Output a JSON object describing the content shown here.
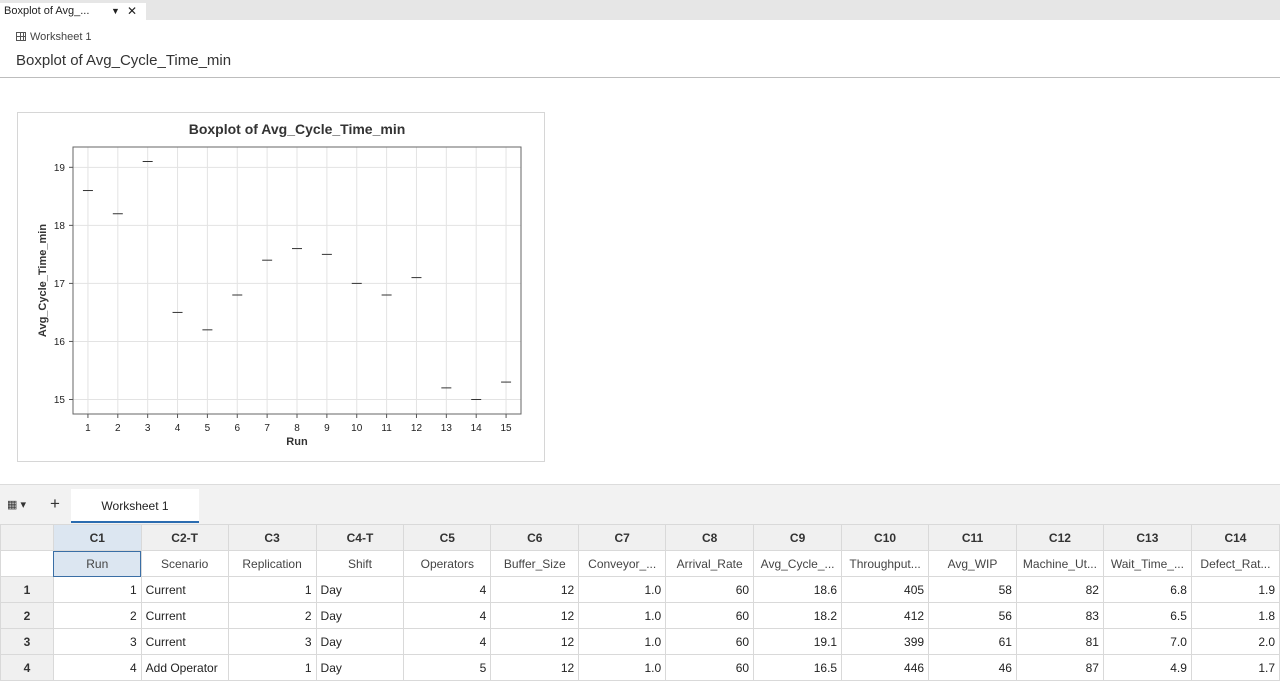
{
  "tab": {
    "title": "Boxplot of Avg_...",
    "caret": "▼",
    "close": "✕"
  },
  "worksheet_ref": "Worksheet 1",
  "page_title": "Boxplot of Avg_Cycle_Time_min",
  "sheet_tabs": {
    "menu_icon": "▦ ▾",
    "add": "+",
    "active": "Worksheet 1"
  },
  "chart_data": {
    "type": "boxplot",
    "title": "Boxplot of Avg_Cycle_Time_min",
    "xlabel": "Run",
    "ylabel": "Avg_Cycle_Time_min",
    "categories": [
      "1",
      "2",
      "3",
      "4",
      "5",
      "6",
      "7",
      "8",
      "9",
      "10",
      "11",
      "12",
      "13",
      "14",
      "15"
    ],
    "values": [
      18.6,
      18.2,
      19.1,
      16.5,
      16.2,
      16.8,
      17.4,
      17.6,
      17.5,
      17.0,
      16.8,
      17.1,
      15.2,
      15.0,
      15.3
    ],
    "yticks": [
      15,
      16,
      17,
      18,
      19
    ],
    "ylim": [
      14.75,
      19.35
    ],
    "grid": true
  },
  "table": {
    "col_ids": [
      "C1",
      "C2-T",
      "C3",
      "C4-T",
      "C5",
      "C6",
      "C7",
      "C8",
      "C9",
      "C10",
      "C11",
      "C12",
      "C13",
      "C14"
    ],
    "col_names": [
      "Run",
      "Scenario",
      "Replication",
      "Shift",
      "Operators",
      "Buffer_Size",
      "Conveyor_...",
      "Arrival_Rate",
      "Avg_Cycle_...",
      "Throughput...",
      "Avg_WIP",
      "Machine_Ut...",
      "Wait_Time_...",
      "Defect_Rat..."
    ],
    "rows": [
      {
        "row": "1",
        "cells": [
          "1",
          "Current",
          "1",
          "Day",
          "4",
          "12",
          "1.0",
          "60",
          "18.6",
          "405",
          "58",
          "82",
          "6.8",
          "1.9"
        ]
      },
      {
        "row": "2",
        "cells": [
          "2",
          "Current",
          "2",
          "Day",
          "4",
          "12",
          "1.0",
          "60",
          "18.2",
          "412",
          "56",
          "83",
          "6.5",
          "1.8"
        ]
      },
      {
        "row": "3",
        "cells": [
          "3",
          "Current",
          "3",
          "Day",
          "4",
          "12",
          "1.0",
          "60",
          "19.1",
          "399",
          "61",
          "81",
          "7.0",
          "2.0"
        ]
      },
      {
        "row": "4",
        "cells": [
          "4",
          "Add Operator",
          "1",
          "Day",
          "5",
          "12",
          "1.0",
          "60",
          "16.5",
          "446",
          "46",
          "87",
          "4.9",
          "1.7"
        ]
      }
    ]
  }
}
